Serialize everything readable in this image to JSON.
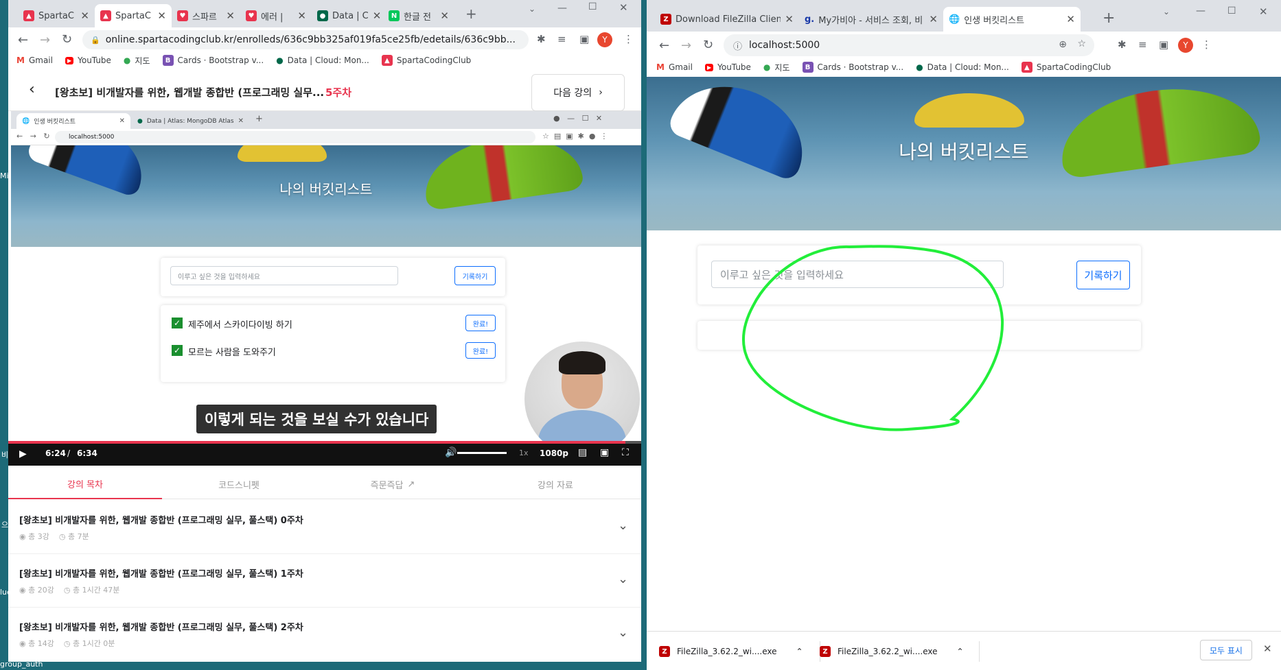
{
  "left_window": {
    "tabs": [
      "SpartaC",
      "SpartaC",
      "스파르",
      "에러 | ",
      "Data | C",
      "한글 전"
    ],
    "url": "online.spartacodingclub.kr/enrolleds/636c9bb325af019fa5ce25fb/edetails/636c9bb...",
    "bookmarks": [
      "Gmail",
      "YouTube",
      "지도",
      "Cards · Bootstrap v...",
      "Data | Cloud: Mon...",
      "SpartaCodingClub"
    ],
    "avatar": "Y",
    "course_title": "[왕초보] 비개발자를 위한, 웹개발 종합반 (프로그래밍 실무...",
    "week": "5주차",
    "next_lecture": "다음 강의",
    "video": {
      "inner_tabs": [
        "인생 버킷리스트",
        "Data | Atlas: MongoDB Atlas"
      ],
      "inner_url": "localhost:5000",
      "hero_title": "나의 버킷리스트",
      "input_placeholder": "이루고 싶은 것을 입력하세요",
      "record_button": "기록하기",
      "items": [
        {
          "text": "제주에서 스카이다이빙 하기",
          "button": "완료!"
        },
        {
          "text": "모르는 사람을 도와주기",
          "button": "완료!"
        }
      ],
      "subtitle": "이렇게 되는 것을 보실 수가 있습니다",
      "time_current": "6:24",
      "time_sep": "/",
      "time_total": "6:34",
      "speed": "1x",
      "quality": "1080p",
      "progress": 0.975
    },
    "course_tabs": [
      "강의 목차",
      "코드스니펫",
      "즉문즉답",
      "강의 자료"
    ],
    "weeks": [
      {
        "title": "[왕초보] 비개발자를 위한, 웹개발 종합반 (프로그래밍 실무, 풀스택) 0주차",
        "lectures": "총 3강",
        "duration": "총 7분"
      },
      {
        "title": "[왕초보] 비개발자를 위한, 웹개발 종합반 (프로그래밍 실무, 풀스택) 1주차",
        "lectures": "총 20강",
        "duration": "총 1시간 47분"
      },
      {
        "title": "[왕초보] 비개발자를 위한, 웹개발 종합반 (프로그래밍 실무, 풀스택) 2주차",
        "lectures": "총 14강",
        "duration": "총 1시간 0분"
      }
    ]
  },
  "right_window": {
    "tabs": [
      "Download FileZilla Client fo",
      "My가비아 - 서비스 조회, 비",
      "인생 버킷리스트"
    ],
    "url": "localhost:5000",
    "bookmarks": [
      "Gmail",
      "YouTube",
      "지도",
      "Cards · Bootstrap v...",
      "Data | Cloud: Mon...",
      "SpartaCodingClub"
    ],
    "avatar": "Y",
    "hero_title": "나의 버킷리스트",
    "input_placeholder": "이루고 싶은 것을 입력하세요",
    "record_button": "기록하기",
    "downloads": [
      "FileZilla_3.62.2_wi....exe",
      "FileZilla_3.62.2_wi....exe"
    ],
    "show_all": "모두 표시"
  },
  "desktop_fragments": [
    "Mi",
    "비",
    "으",
    "lue",
    "group_auth"
  ],
  "colors": {
    "accent_red": "#e8344e",
    "blue": "#0d6efd",
    "green_scribble": "#22ee3a"
  }
}
